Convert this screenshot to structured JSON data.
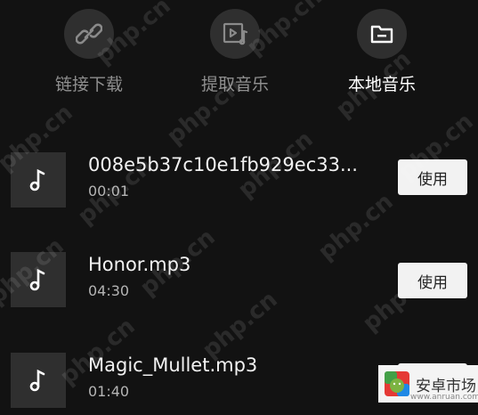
{
  "tabs": [
    {
      "label": "链接下载",
      "icon": "link-icon",
      "active": false
    },
    {
      "label": "提取音乐",
      "icon": "video-music-icon",
      "active": false
    },
    {
      "label": "本地音乐",
      "icon": "folder-icon",
      "active": true
    }
  ],
  "songs": [
    {
      "title": "008e5b37c10e1fb929ec33...",
      "duration": "00:01",
      "action": "使用",
      "icon": "music-note-icon"
    },
    {
      "title": "Honor.mp3",
      "duration": "04:30",
      "action": "使用",
      "icon": "music-note-icon"
    },
    {
      "title": "Magic_Mullet.mp3",
      "duration": "01:40",
      "action": "使用",
      "icon": "music-note-icon"
    }
  ],
  "watermark": {
    "text": "php.cn"
  },
  "brand": {
    "text": "安卓市场",
    "sub": "www.anruan.com"
  },
  "colors": {
    "background": "#121212",
    "tile": "#2f2f2f",
    "button": "#f2f2f2"
  }
}
